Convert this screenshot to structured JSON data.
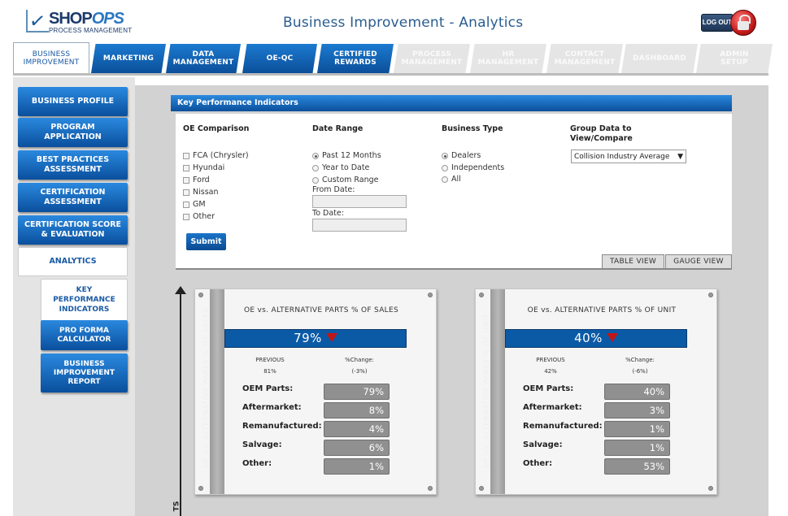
{
  "header": {
    "logo_shop": "SHOP",
    "logo_ops": "OPS",
    "logo_sub": "PROCESS MANAGEMENT",
    "title": "Business Improvement - Analytics",
    "logout_label": "LOG OUT"
  },
  "tabs": [
    {
      "label": "BUSINESS IMPROVEMENT",
      "state": "active"
    },
    {
      "label": "MARKETING",
      "state": "blue"
    },
    {
      "label": "DATA MANAGEMENT",
      "state": "blue"
    },
    {
      "label": "OE-QC",
      "state": "blue"
    },
    {
      "label": "CERTIFIED REWARDS",
      "state": "blue"
    },
    {
      "label": "PROCESS MANAGEMENT",
      "state": "disabled"
    },
    {
      "label": "HR MANAGEMENT",
      "state": "disabled"
    },
    {
      "label": "CONTACT MANAGEMENT",
      "state": "disabled"
    },
    {
      "label": "DASHBOARD",
      "state": "disabled"
    },
    {
      "label": "ADMIN SETUP",
      "state": "disabled"
    }
  ],
  "sidebar": {
    "items": [
      {
        "label": "BUSINESS PROFILE"
      },
      {
        "label": "PROGRAM APPLICATION"
      },
      {
        "label": "BEST PRACTICES ASSESSMENT"
      },
      {
        "label": "CERTIFICATION ASSESSMENT"
      },
      {
        "label": "CERTIFICATION SCORE & EVALUATION"
      },
      {
        "label": "ANALYTICS"
      }
    ],
    "subitems": [
      {
        "label": "KEY PERFORMANCE INDICATORS"
      },
      {
        "label": "PRO FORMA CALCULATOR"
      },
      {
        "label": "BUSINESS IMPROVEMENT REPORT"
      }
    ]
  },
  "kpi": {
    "section_title": "Key Performance Indicators",
    "oe_title": "OE Comparison",
    "oe_options": [
      "FCA (Chrysler)",
      "Hyundai",
      "Ford",
      "Nissan",
      "GM",
      "Other"
    ],
    "date_title": "Date Range",
    "date_options": [
      "Past 12 Months",
      "Year to Date",
      "Custom Range"
    ],
    "date_selected": "Past 12 Months",
    "from_label": "From Date:",
    "to_label": "To Date:",
    "from_value": "",
    "to_value": "",
    "btype_title": "Business Type",
    "btype_options": [
      "Dealers",
      "Independents",
      "All"
    ],
    "btype_selected": "Dealers",
    "group_title": "Group Data to View/Compare",
    "group_value": "Collision Industry Average",
    "submit_label": "Submit",
    "table_view_label": "TABLE VIEW",
    "gauge_view_label": "GAUGE VIEW",
    "axis_label_fragment": "TS"
  },
  "cards": [
    {
      "title": "OE vs. ALTERNATIVE PARTS % OF SALES",
      "side_label": "OE vs. ALTERNATIVE PARTS % OF SALES",
      "value": "79%",
      "previous_label": "PREVIOUS",
      "previous_value": "81%",
      "change_label": "%Change:",
      "change_value": "(-3%)",
      "rows": [
        {
          "label": "OEM Parts:",
          "value": "79%"
        },
        {
          "label": "Aftermarket:",
          "value": "8%"
        },
        {
          "label": "Remanufactured:",
          "value": "4%"
        },
        {
          "label": "Salvage:",
          "value": "6%"
        },
        {
          "label": "Other:",
          "value": "1%"
        }
      ]
    },
    {
      "title": "OE vs. ALTERNATIVE PARTS % OF UNIT",
      "side_label": "OE vs. ALTERNATIVE PARTS % OF UNIT",
      "value": "40%",
      "previous_label": "PREVIOUS",
      "previous_value": "42%",
      "change_label": "%Change:",
      "change_value": "(-6%)",
      "rows": [
        {
          "label": "OEM Parts:",
          "value": "40%"
        },
        {
          "label": "Aftermarket:",
          "value": "3%"
        },
        {
          "label": "Remanufactured:",
          "value": "1%"
        },
        {
          "label": "Salvage:",
          "value": "1%"
        },
        {
          "label": "Other:",
          "value": "53%"
        }
      ]
    }
  ]
}
